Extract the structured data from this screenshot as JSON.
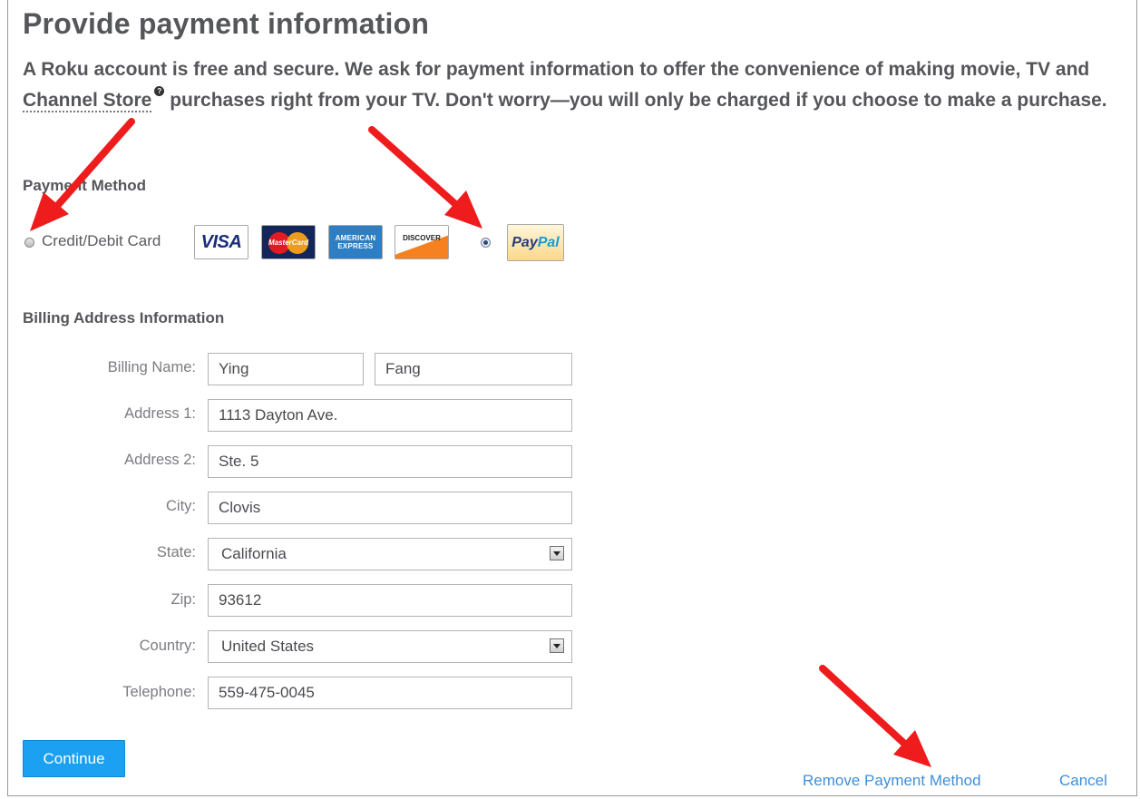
{
  "page": {
    "title": "Provide payment information",
    "intro_before": "A Roku account is free and secure. We ask for payment information to offer the convenience of making movie, TV and ",
    "intro_link": "Channel Store",
    "intro_after": " purchases right from your TV. Don't worry—you will only be charged if you choose to make a purchase."
  },
  "payment": {
    "section_label": "Payment Method",
    "credit_label": "Credit/Debit Card",
    "selected": "paypal",
    "cards": {
      "visa": "VISA",
      "mastercard": "MasterCard",
      "amex_line1": "AMERICAN",
      "amex_line2": "EXPRESS",
      "discover": "DISCOVER",
      "paypal_a": "Pay",
      "paypal_b": "Pal"
    }
  },
  "billing": {
    "section_label": "Billing Address Information",
    "labels": {
      "name": "Billing Name:",
      "address1": "Address 1:",
      "address2": "Address 2:",
      "city": "City:",
      "state": "State:",
      "zip": "Zip:",
      "country": "Country:",
      "telephone": "Telephone:"
    },
    "values": {
      "first_name": "Ying",
      "last_name": "Fang",
      "address1": "1113 Dayton Ave.",
      "address2": "Ste. 5",
      "city": "Clovis",
      "state": "California",
      "zip": "93612",
      "country": "United States",
      "telephone": "559-475-0045"
    }
  },
  "actions": {
    "continue": "Continue",
    "remove": "Remove Payment Method",
    "cancel": "Cancel"
  },
  "colors": {
    "accent_blue": "#1ba0f2",
    "link_blue": "#3f8fd8",
    "annotation_red": "#ee1c1c"
  }
}
